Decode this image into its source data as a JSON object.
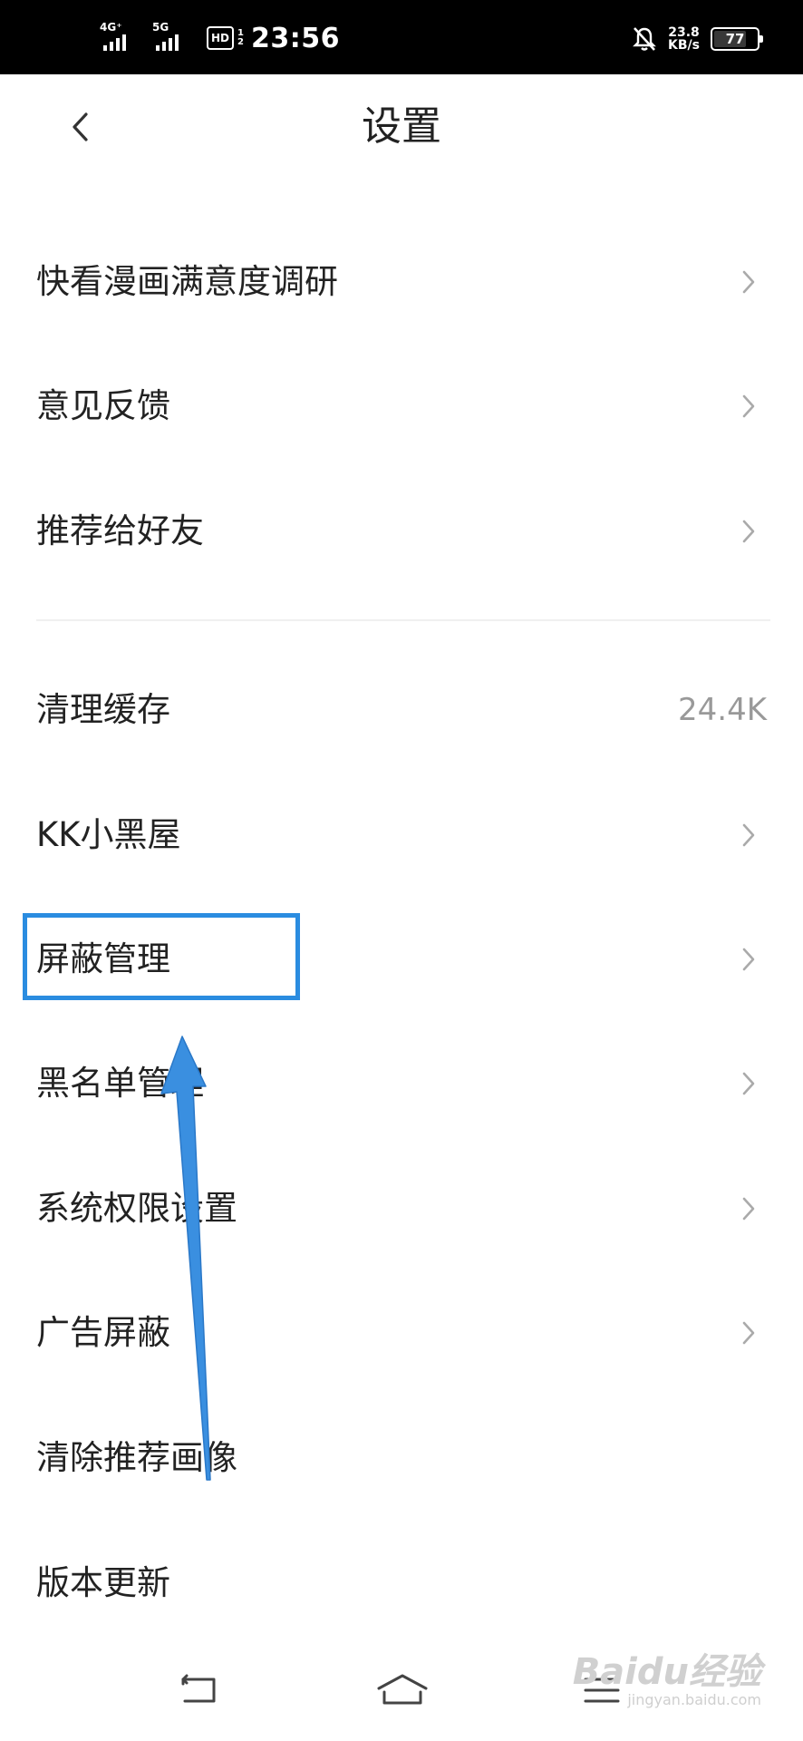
{
  "status_bar": {
    "sim1_tag": "4G⁺",
    "sim2_tag": "5G",
    "hd_label": "HD",
    "hd_nums": "1\n2",
    "time": "23:56",
    "speed_value": "23.8",
    "speed_unit": "KB/s",
    "battery_level": "77",
    "battery_fraction": 0.77,
    "icons": [
      "signal-icon",
      "signal-icon",
      "hd-icon",
      "bell-off-icon",
      "battery-icon"
    ]
  },
  "header": {
    "title": "设置",
    "back_icon": "chevron-left-icon"
  },
  "settings": {
    "items": [
      {
        "label": "快看漫画满意度调研",
        "trailing": "chevron-right-icon"
      },
      {
        "label": "意见反馈",
        "trailing": "chevron-right-icon"
      },
      {
        "label": "推荐给好友",
        "trailing": "chevron-right-icon"
      },
      {
        "label": "清理缓存",
        "value": "24.4K"
      },
      {
        "label": "KK小黑屋",
        "trailing": "chevron-right-icon"
      },
      {
        "label": "屏蔽管理",
        "trailing": "chevron-right-icon",
        "highlighted": true
      },
      {
        "label": "黑名单管理",
        "trailing": "chevron-right-icon"
      },
      {
        "label": "系统权限设置",
        "trailing": "chevron-right-icon"
      },
      {
        "label": "广告屏蔽",
        "trailing": "chevron-right-icon"
      },
      {
        "label": "清除推荐画像"
      },
      {
        "label": "版本更新"
      }
    ]
  },
  "annotation": {
    "box_color": "#2a8ce0",
    "arrow_color": "#3a8fe0"
  },
  "nav_bar": {
    "icons": [
      "back-nav-icon",
      "home-nav-icon",
      "menu-nav-icon"
    ]
  },
  "watermark": {
    "brand": "Baidu经验",
    "url": "jingyan.baidu.com"
  }
}
